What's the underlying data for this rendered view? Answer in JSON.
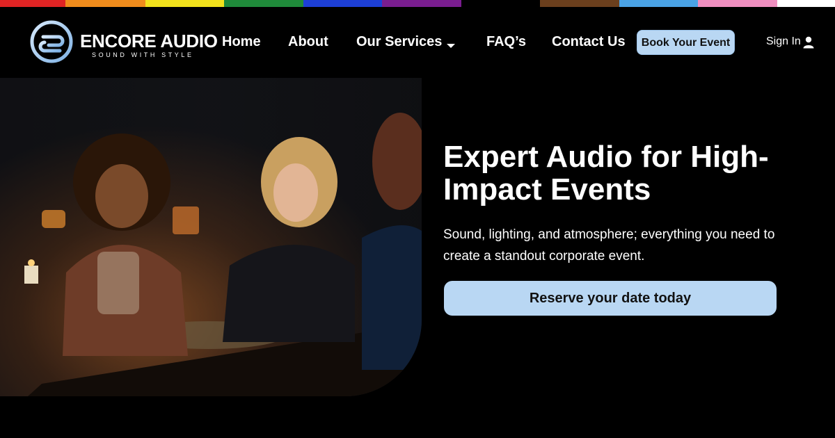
{
  "brand": {
    "name": "ENCORE AUDIO",
    "tagline": "SOUND WITH STYLE",
    "logo_icon": "ea-monogram-icon",
    "accent_color": "#b9d7f3"
  },
  "rainbow_colors": [
    "#e02424",
    "#f08c1c",
    "#f2e21c",
    "#1f8a3a",
    "#1d3fd6",
    "#7a1d8f",
    "#000000",
    "#6b3f1d",
    "#4aa3e6",
    "#f08fc0",
    "#ffffff"
  ],
  "nav": {
    "items": [
      {
        "label": "Home"
      },
      {
        "label": "About"
      },
      {
        "label": "Our Services",
        "icon": "caret-down-icon"
      },
      {
        "label": "FAQ’s"
      },
      {
        "label": "Contact Us"
      }
    ],
    "book_label": "Book Your Event",
    "signin_label": "Sign In",
    "signin_icon": "user-icon"
  },
  "hero": {
    "title": "Expert Audio for High-Impact Events",
    "subtitle": "Sound, lighting, and atmosphere; everything you need to create a standout corporate event.",
    "cta_label": "Reserve your date today"
  }
}
